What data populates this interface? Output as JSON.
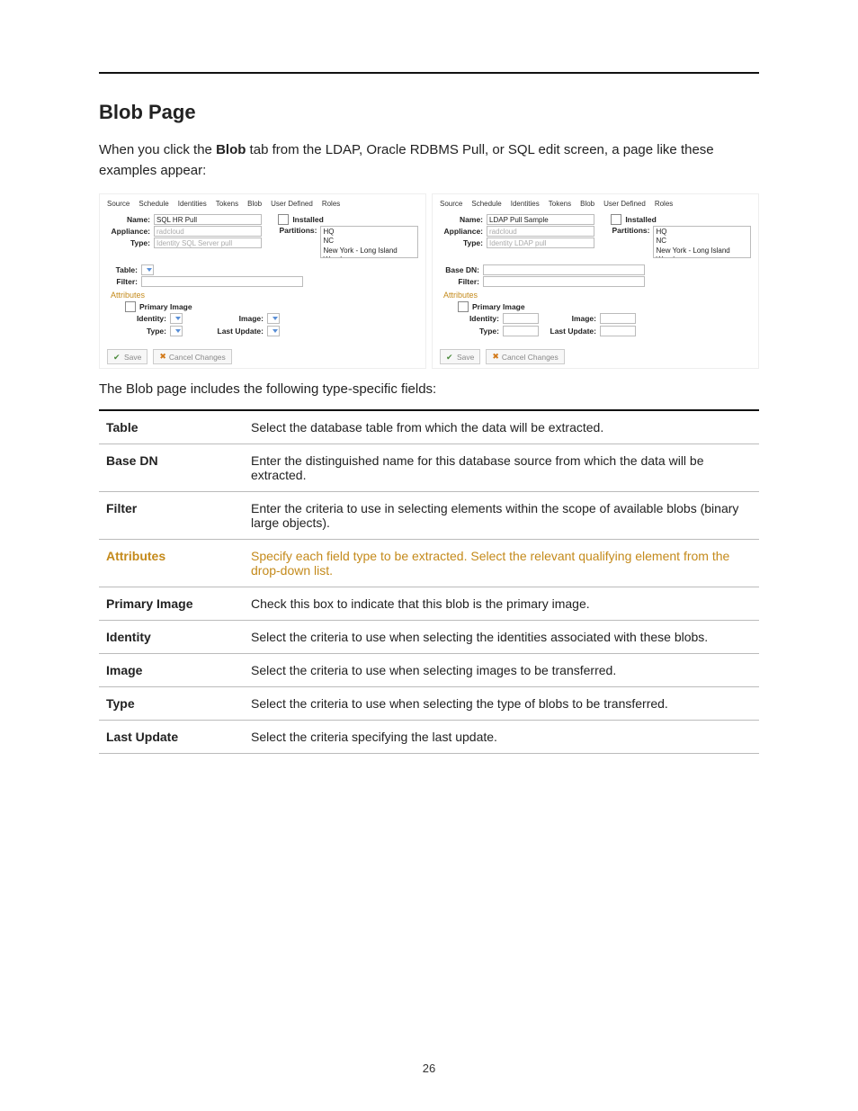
{
  "heading": "Blob Page",
  "intro_pre": "When you click the ",
  "intro_bold": "Blob",
  "intro_post": " tab  from the LDAP, Oracle RDBMS Pull, or SQL edit screen, a page like these examples appear:",
  "after_shots": "The Blob page includes the following type-specific fields:",
  "page_number": "26",
  "tabs": [
    "Source",
    "Schedule",
    "Identities",
    "Tokens",
    "Blob",
    "User Defined",
    "Roles"
  ],
  "labels": {
    "name": "Name:",
    "appliance": "Appliance:",
    "type": "Type:",
    "installed": "Installed",
    "partitions": "Partitions:",
    "table": "Table:",
    "basedn": "Base DN:",
    "filter": "Filter:",
    "attributes": "Attributes",
    "primary_image": "Primary Image",
    "identity": "Identity:",
    "image": "Image:",
    "typef": "Type:",
    "last_update": "Last Update:",
    "save": "Save",
    "cancel": "Cancel Changes"
  },
  "partitions": [
    "HQ",
    "NC",
    "New York - Long Island Warehouse"
  ],
  "shot1": {
    "name": "SQL HR Pull",
    "appliance": "radcloud",
    "type": "Identity SQL Server pull"
  },
  "shot2": {
    "name": "LDAP Pull Sample",
    "appliance": "radcloud",
    "type": "Identity LDAP pull"
  },
  "defs": [
    {
      "term": "Table",
      "desc": "Select the database table from which the data will be extracted."
    },
    {
      "term": "Base DN",
      "desc": "Enter the distinguished name for this database source from which the data will be extracted."
    },
    {
      "term": "Filter",
      "desc": "Enter the criteria to use in selecting elements within the scope of available blobs (binary large objects)."
    },
    {
      "term": "Attributes",
      "desc": "Specify each field type to be extracted. Select the relevant qualifying element from the drop-down list.",
      "hl": true
    },
    {
      "term": "Primary Image",
      "desc": "Check this box to indicate that this blob is the primary image."
    },
    {
      "term": "Identity",
      "desc": "Select the criteria to use when selecting the identities associated with these blobs."
    },
    {
      "term": "Image",
      "desc": "Select the criteria to use when selecting images to be transferred."
    },
    {
      "term": "Type",
      "desc": "Select the criteria to use when selecting the type of blobs to be transferred."
    },
    {
      "term": "Last Update",
      "desc": "Select the criteria specifying the last update."
    }
  ]
}
